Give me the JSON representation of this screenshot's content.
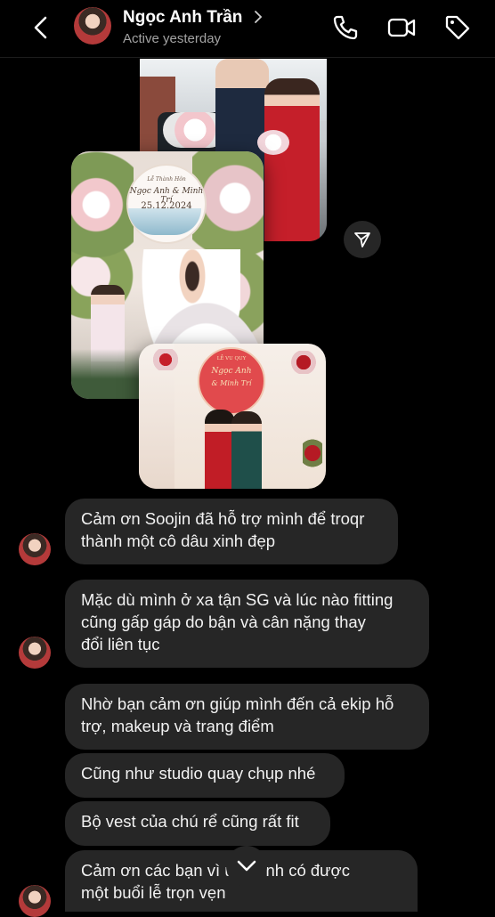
{
  "header": {
    "contact_name": "Ngọc Anh Trần",
    "status": "Active yesterday",
    "icons": [
      "back-icon",
      "phone-icon",
      "video-icon",
      "tag-icon"
    ]
  },
  "photos": {
    "p2_sign_line1": "Lễ Thành Hôn",
    "p2_sign_line2": "Ngọc Anh & Minh Trí",
    "p2_sign_date": "25.12.2024",
    "p3_sign_line1": "LỄ VU QUY",
    "p3_sign_line2": "Ngọc Anh",
    "p3_sign_line3": "& Minh Trí"
  },
  "messages": [
    {
      "text": "Cảm ơn Soojin đã hỗ trợ mình để troqr\nthành một cô dâu xinh đẹp"
    },
    {
      "text": "Mặc dù mình ở xa tận SG và lúc nào fitting\ncũng gấp gáp do bận và cân nặng thay\nđổi liên tục"
    },
    {
      "text": "Nhờ bạn cảm ơn giúp mình đến cả ekip hỗ\ntrợ, makeup và trang điểm"
    },
    {
      "text": "Cũng như studio quay chụp nhé"
    },
    {
      "text": "Bộ vest của chú rể cũng rất fit"
    },
    {
      "text": "Cảm ơn các bạn vì        úp mình có được\nmột buổi lễ trọn vẹn"
    }
  ],
  "colors": {
    "background": "#000000",
    "bubble": "#262626",
    "text": "#f2f2f2",
    "muted": "#a3a3a3"
  }
}
